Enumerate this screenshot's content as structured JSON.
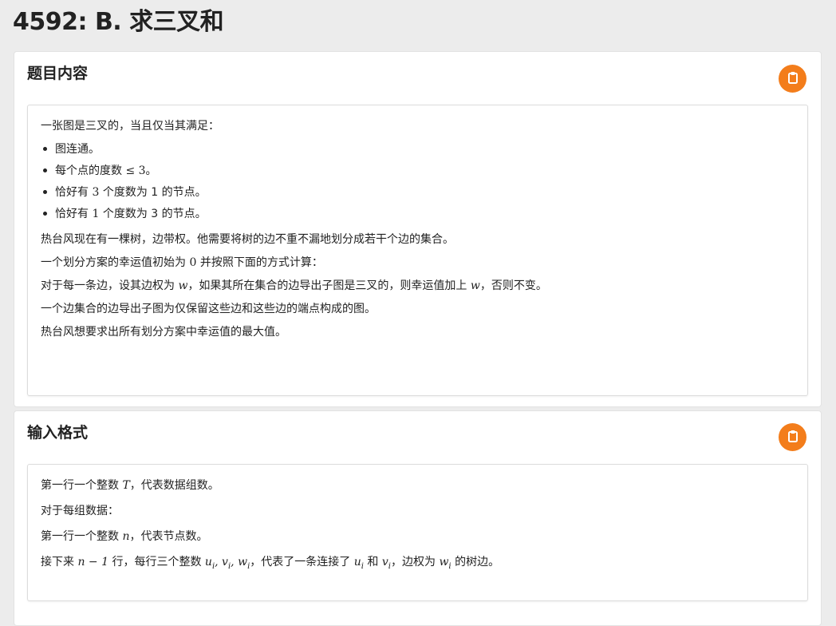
{
  "page": {
    "title": "4592: B. 求三叉和"
  },
  "sections": [
    {
      "header": "题目内容",
      "copy_icon": "clipboard-icon",
      "intro": "一张图是三叉的，当且仅当其满足：",
      "conditions": [
        {
          "pre": "图连通。",
          "math": "",
          "post": ""
        },
        {
          "pre": "每个点的度数",
          "math": "≤ 3",
          "post": "。"
        },
        {
          "pre": "恰好有",
          "math": "3",
          "post": "个度数为 1 的节点。"
        },
        {
          "pre": "恰好有",
          "math": "1",
          "post": "个度数为 3 的节点。"
        }
      ],
      "p1": "热台风现在有一棵树，边带权。他需要将树的边不重不漏地划分成若干个边的集合。",
      "p2_pre": "一个划分方案的幸运值初始为",
      "p2_math": "0",
      "p2_post": "并按照下面的方式计算：",
      "p3_pre": "对于每一条边，设其边权为",
      "p3_var": "w",
      "p3_mid": "，如果其所在集合的边导出子图是三叉的，则幸运值加上",
      "p3_var2": "w",
      "p3_post": "，否则不变。",
      "p4": "一个边集合的边导出子图为仅保留这些边和这些边的端点构成的图。",
      "p5": "热台风想要求出所有划分方案中幸运值的最大值。"
    },
    {
      "header": "输入格式",
      "copy_icon": "clipboard-icon",
      "l1_pre": "第一行一个整数",
      "l1_var": "T",
      "l1_post": "，代表数据组数。",
      "l2": "对于每组数据：",
      "l3_pre": "第一行一个整数",
      "l3_var": "n",
      "l3_post": "，代表节点数。",
      "l4_pre": "接下来",
      "l4_math": "n − 1",
      "l4_mid1": "行，每行三个整数",
      "l4_vars": "u",
      "l4_mid2": "和",
      "l4_mid3": "，边权为",
      "l4_post": "的树边。",
      "l4_sep": "，代表了一条连接了"
    }
  ]
}
